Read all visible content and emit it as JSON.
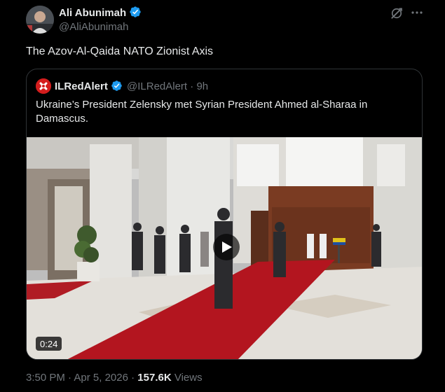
{
  "author": {
    "name": "Ali Abunimah",
    "handle": "@AliAbunimah"
  },
  "tweet": {
    "text": "The Azov-Al-Qaida NATO Zionist Axis"
  },
  "quote": {
    "name": "ILRedAlert",
    "handle": "@ILRedAlert",
    "separator": "·",
    "time": "9h",
    "text": "Ukraine’s President Zelensky met Syrian President Ahmed al-Sharaa in Damascus."
  },
  "video": {
    "duration": "0:24"
  },
  "footer": {
    "time": "3:50 PM",
    "date": "Apr 5, 2026",
    "views_count": "157.6K",
    "views_label": "Views"
  },
  "colors": {
    "background": "#000000",
    "text_primary": "#e7e9ea",
    "text_secondary": "#71767b",
    "verified_blue": "#1d9bf0",
    "border": "#2f3336",
    "red_badge": "#d41d1d"
  },
  "icons": {
    "verified": "verified-badge-icon",
    "grok": "grok-icon",
    "more": "more-options-icon",
    "play": "play-icon"
  }
}
